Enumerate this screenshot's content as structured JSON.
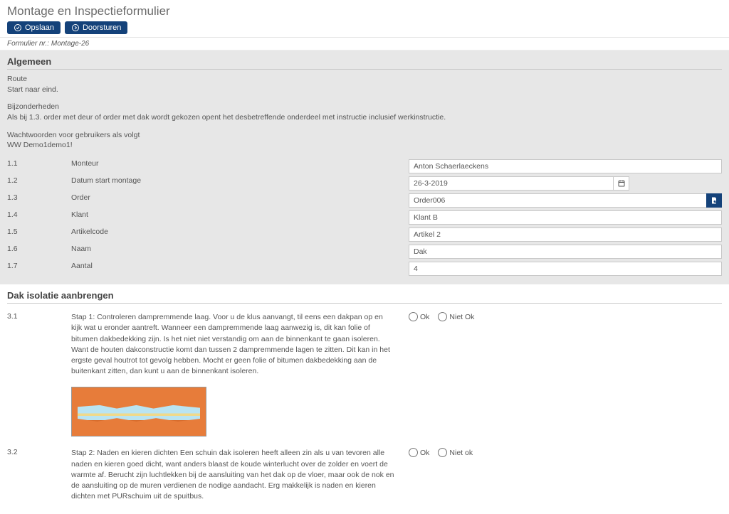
{
  "header": {
    "title": "Montage en Inspectieformulier",
    "save_label": "Opslaan",
    "forward_label": "Doorsturen"
  },
  "form_meta": "Formulier nr.:  Montage-26",
  "section_general": {
    "title": "Algemeen",
    "intro": {
      "route_label": "Route",
      "route_text": "Start naar eind.",
      "bijz_label": "Bijzonderheden",
      "bijz_text": "Als bij 1.3. order met deur of order met dak wordt gekozen opent  het desbetreffende onderdeel met instructie inclusief werkinstructie.",
      "ww_label": "Wachtwoorden voor gebruikers als volgt",
      "ww_text": "WW Demo1demo1!"
    },
    "rows": [
      {
        "num": "1.1",
        "label": "Monteur",
        "type": "text",
        "value": "Anton Schaerlaeckens"
      },
      {
        "num": "1.2",
        "label": "Datum start montage",
        "type": "date",
        "value": "26-3-2019"
      },
      {
        "num": "1.3",
        "label": "Order",
        "type": "lookup",
        "value": "Order006"
      },
      {
        "num": "1.4",
        "label": "Klant",
        "type": "text",
        "value": "Klant B"
      },
      {
        "num": "1.5",
        "label": "Artikelcode",
        "type": "text",
        "value": "Artikel 2"
      },
      {
        "num": "1.6",
        "label": "Naam",
        "type": "text",
        "value": "Dak"
      },
      {
        "num": "1.7",
        "label": "Aantal",
        "type": "text",
        "value": "4"
      }
    ]
  },
  "section_dak": {
    "title": "Dak isolatie aanbrengen",
    "ok_label": "Ok",
    "nok_label": "Niet Ok",
    "nok_label_lc": "Niet ok",
    "steps": [
      {
        "num": "3.1",
        "text": "Stap 1: Controleren dampremmende laag. Voor u de klus aanvangt, til eens een dakpan op en kijk wat u eronder aantreft. Wanneer een dampremmende laag aanwezig is, dit kan folie of bitumen dakbedekking zijn. Is het niet niet verstandig om aan de binnenkant te gaan isoleren. Want de houten dakconstructie komt dan tussen 2 dampremmende lagen te zitten. Dit kan in het ergste geval houtrot tot gevolg hebben. Mocht er geen folie of bitumen dakbedekking aan de buitenkant zitten, dan kunt u aan de binnenkant isoleren.",
        "has_image": true
      },
      {
        "num": "3.2",
        "text": "Stap 2: Naden en kieren dichten Een schuin dak isoleren heeft alleen zin als u van tevoren alle naden en kieren goed dicht, want anders blaast de koude winterlucht over de zolder en voert de warmte af. Berucht zijn luchtlekken bij de aansluiting van het dak op de vloer, maar ook de nok en de aansluiting op de muren verdienen de nodige aandacht. Erg makkelijk is naden en kieren dichten met PURschuim uit de spuitbus.",
        "has_image": false
      }
    ]
  }
}
